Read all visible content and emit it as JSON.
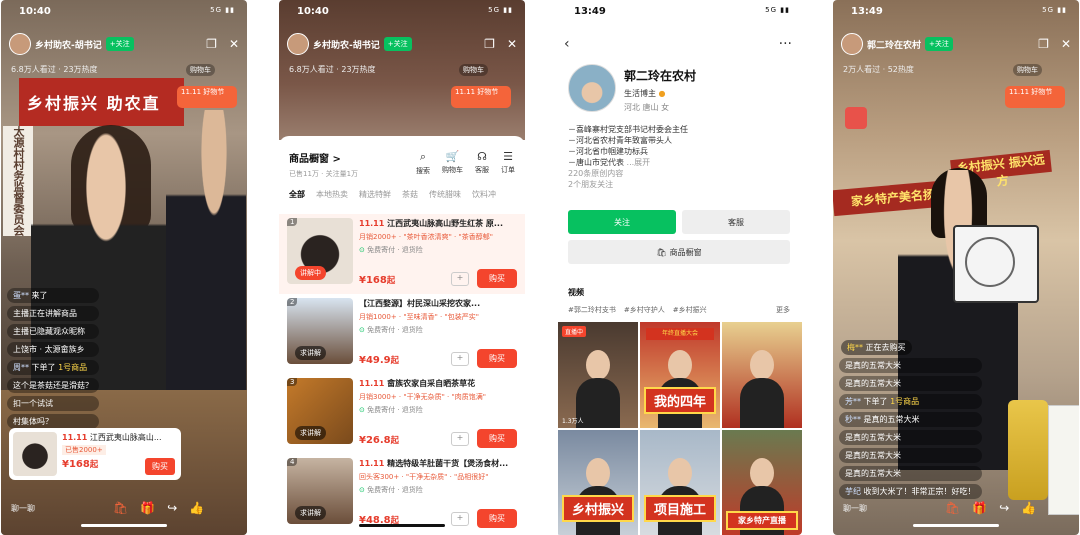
{
  "screen1": {
    "time": "10:40",
    "signal": "5G",
    "anchor_name": "乡村助农-胡书记",
    "follow_label": "+关注",
    "viewers": "6.8万人看过 · 23万热度",
    "cart_label": "购物车",
    "promo": "11.11 好物节",
    "banner": "乡村振兴 助农直",
    "sign": "太源村村务监督委员会",
    "comments": [
      {
        "name": "蛋**",
        "text": "来了"
      },
      {
        "name": "",
        "text": "",
        "dim": "主播正在讲解商品"
      },
      {
        "name": "",
        "text": "主播已隐藏观众昵称"
      },
      {
        "name": "",
        "text": "上饶市 · 太源畲族乡"
      },
      {
        "name": "周**",
        "text": "下单了",
        "hl": "1号商品"
      },
      {
        "name": "",
        "text": "这个是茶菇还是滑菇？"
      },
      {
        "name": "",
        "text": "扣一个试试"
      },
      {
        "name": "",
        "text": "村集体吗？"
      }
    ],
    "product": {
      "tag": "11.11",
      "title": "江西武夷山脉高山...",
      "sold": "已售2000+",
      "price": "¥168",
      "price_suffix": "起",
      "buy": "购买"
    },
    "say_placeholder": "聊一聊"
  },
  "screen2": {
    "time": "10:40",
    "signal": "5G",
    "anchor_name": "乡村助农-胡书记",
    "follow_label": "+关注",
    "viewers": "6.8万人看过 · 23万热度",
    "cart_label": "购物车",
    "promo": "11.11 好物节",
    "shop_title": "商品橱窗 >",
    "shop_sub": "已售11万 · 关注量1万",
    "shop_icons": [
      {
        "icon": "search-icon",
        "label": "搜索",
        "glyph": "⌕"
      },
      {
        "icon": "cart-icon",
        "label": "购物车",
        "glyph": "🛒"
      },
      {
        "icon": "service-icon",
        "label": "客服",
        "glyph": "☊"
      },
      {
        "icon": "order-icon",
        "label": "订单",
        "glyph": "☰"
      }
    ],
    "tabs": [
      "全部",
      "本地热卖",
      "精选特鲜",
      "茶菇",
      "传统腊味",
      "饮料冲"
    ],
    "products": [
      {
        "idx": "1",
        "tag": "11.11",
        "title": "江西武夷山脉高山野生红茶 原...",
        "sub": "月销2000+ · \"茶叶香浓清爽\" · \"茶香醇郁\"",
        "ship": "免费寄付",
        "ship2": "退货险",
        "price": "¥168",
        "suffix": "起",
        "label": "讲解中",
        "label_red": true,
        "thumb": "radial-gradient(circle at 50% 55%,#2a2320 0 38%,#e8e0d6 40%)",
        "buy": "购买"
      },
      {
        "idx": "2",
        "tag": "",
        "title": "【江西婺源】村民深山采挖农家...",
        "sub": "月销1000+ · \"至味清香\" · \"包装严实\"",
        "ship": "免费寄付",
        "ship2": "退货险",
        "price": "¥49.9",
        "suffix": "起",
        "label": "求讲解",
        "label_red": false,
        "thumb": "linear-gradient(180deg,#d8e4f0,#6a4e3a)",
        "buy": "购买"
      },
      {
        "idx": "3",
        "tag": "11.11",
        "title": "畲族农家自采自晒茶草花",
        "sub": "月销3000+ · \"干净无杂质\" · \"肉质饱满\"",
        "ship": "免费寄付",
        "ship2": "退货险",
        "price": "¥26.8",
        "suffix": "起",
        "label": "求讲解",
        "label_red": false,
        "thumb": "linear-gradient(135deg,#c47a2a,#7a4a1c)",
        "buy": "购买"
      },
      {
        "idx": "4",
        "tag": "11.11",
        "title": "精选特级羊肚菌干货【煲汤食材...",
        "sub": "回头客300+ · \"干净无杂质\" · \"品相很好\"",
        "ship": "免费寄付",
        "ship2": "退货险",
        "price": "¥48.8",
        "suffix": "起",
        "label": "求讲解",
        "label_red": false,
        "thumb": "linear-gradient(180deg,#c6b4a2,#6b4e3a)",
        "buy": "购买"
      }
    ]
  },
  "screen3": {
    "time": "13:49",
    "signal": "5G",
    "back": "‹",
    "more": "···",
    "name": "郭二玲在农村",
    "role": "生活博主",
    "location": "河北 唐山 女",
    "bio": [
      "－喜峰寨村党支部书记村委会主任",
      "－河北省农村青年致富带头人",
      "－河北省巾帼建功标兵",
      "－唐山市党代表",
      "...展开"
    ],
    "stats": "220条原创内容",
    "friends": "2个朋友关注",
    "follow_btn": "关注",
    "service_btn": "客服",
    "shop_btn": "商品橱窗",
    "videos_header": "视频",
    "tags": [
      "#郭二玲村支书",
      "#乡村守护人",
      "#乡村振兴",
      "更多"
    ],
    "grid": [
      {
        "bg": "linear-gradient(180deg,#4a3a30,#8a6a50)",
        "live": "直播中",
        "big": "",
        "count": "1.3万人",
        "ban": ""
      },
      {
        "bg": "linear-gradient(180deg,#c0392b,#e8b870)",
        "live": "",
        "big": "我的四年",
        "count": "",
        "ban": "年终直播大会"
      },
      {
        "bg": "linear-gradient(180deg,#e8d090,#b03020)",
        "live": "",
        "big": "",
        "count": "",
        "ban": ""
      },
      {
        "bg": "linear-gradient(180deg,#7a8aa0,#c8d0d8)",
        "live": "",
        "big": "乡村振兴",
        "count": "",
        "ban": ""
      },
      {
        "bg": "linear-gradient(180deg,#a8b8c8,#d8dce0)",
        "live": "",
        "big": "项目施工",
        "count": "",
        "ban": ""
      },
      {
        "bg": "linear-gradient(180deg,#6a7a50,#c03a28)",
        "live": "",
        "big": "家乡特产直播",
        "count": "",
        "ban": ""
      }
    ]
  },
  "screen4": {
    "time": "13:49",
    "signal": "5G",
    "anchor_name": "郭二玲在农村",
    "follow_label": "+关注",
    "viewers": "2万人看过 · 52热度",
    "cart_label": "购物车",
    "promo": "11.11 好物节",
    "banner_a": "乡村振兴 振兴远方",
    "banner_b": "家乡特产美名扬",
    "buying": {
      "name": "梅**",
      "text": "正在去购买"
    },
    "comments": [
      {
        "name": "",
        "text": "是真的五常大米"
      },
      {
        "name": "",
        "text": "是真的五常大米"
      },
      {
        "name": "芳**",
        "text": "下单了",
        "hl": "1号商品"
      },
      {
        "name": "秒**",
        "text": "是真的五常大米"
      },
      {
        "name": "",
        "text": "是真的五常大米"
      },
      {
        "name": "",
        "text": "是真的五常大米"
      },
      {
        "name": "",
        "text": "是真的五常大米"
      },
      {
        "name": "芋纪",
        "text": "收到大米了！非常正宗！好吃！"
      }
    ],
    "say_placeholder": "聊一聊"
  }
}
